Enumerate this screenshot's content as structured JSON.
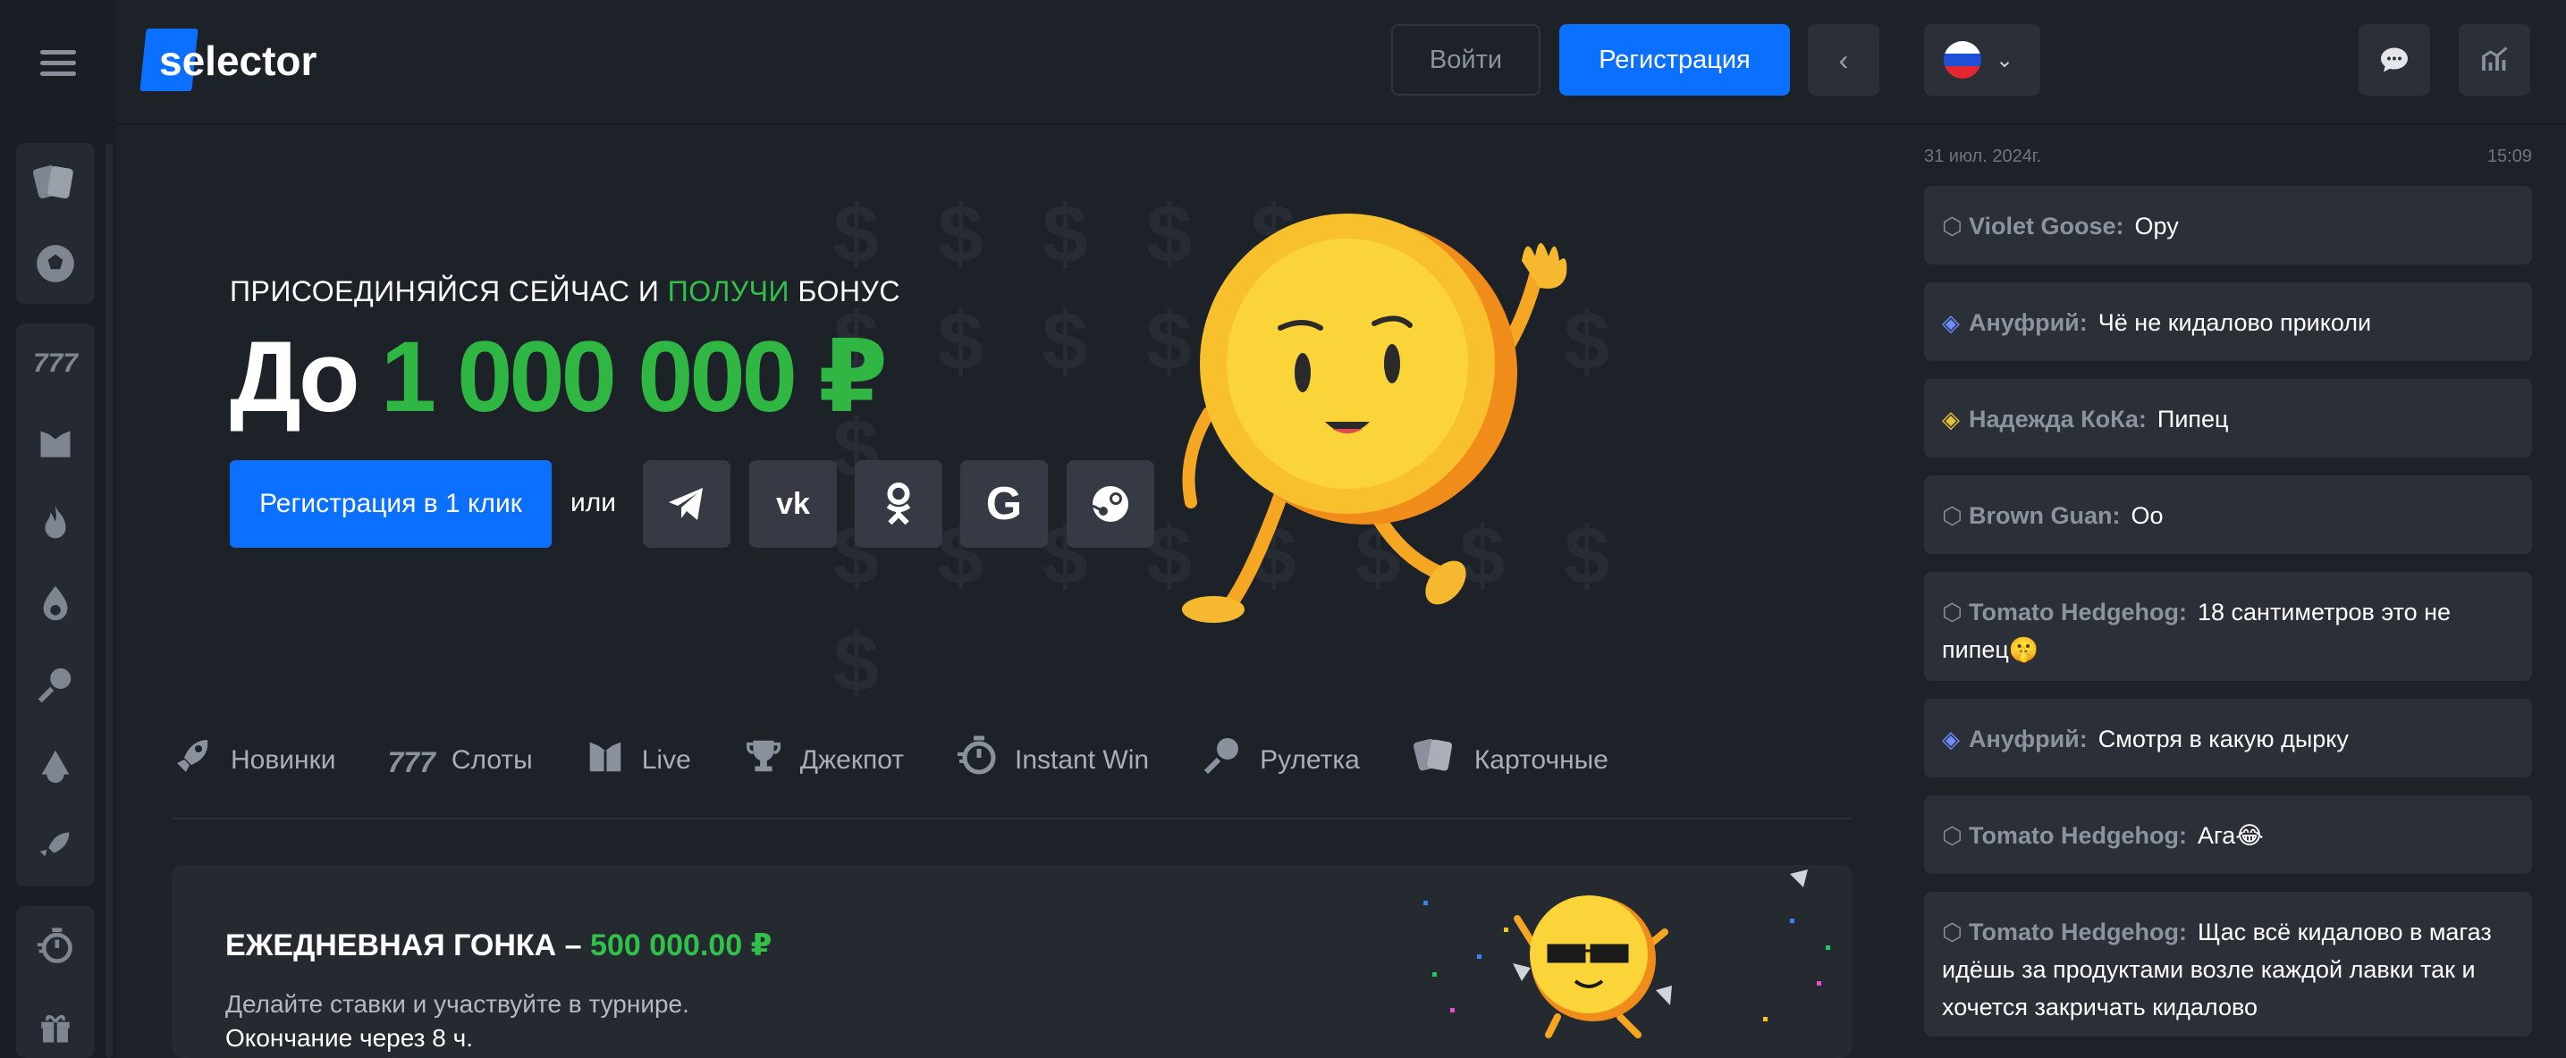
{
  "header": {
    "logo": "selector",
    "login_label": "Войти",
    "register_label": "Регистрация"
  },
  "colors": {
    "accent": "#0b6fff",
    "green": "#31c14a",
    "bg": "#1d2128"
  },
  "banner": {
    "sub_part1": "ПРИСОЕДИНЯЙСЯ СЕЙЧАС И ",
    "sub_green": "ПОЛУЧИ",
    "sub_part2": " БОНУС",
    "title_prefix": "До ",
    "title_amount": "1 000 000 ₽",
    "cta": "Регистрация в 1 клик",
    "or": "или",
    "socials": [
      "telegram-icon",
      "vk-icon",
      "odnoklassniki-icon",
      "google-icon",
      "steam-icon"
    ]
  },
  "tabs": [
    {
      "label": "Новинки",
      "icon": "rocket-icon"
    },
    {
      "label": "Слоты",
      "icon": "slots-777-icon"
    },
    {
      "label": "Live",
      "icon": "live-dealer-icon"
    },
    {
      "label": "Джекпот",
      "icon": "trophy-icon"
    },
    {
      "label": "Instant Win",
      "icon": "stopwatch-icon"
    },
    {
      "label": "Рулетка",
      "icon": "roulette-icon"
    },
    {
      "label": "Карточные",
      "icon": "cards-icon"
    }
  ],
  "tournament": {
    "title": "ЕЖЕДНЕВНАЯ ГОНКА – ",
    "amount": "500 000.00 ₽",
    "desc": "Делайте ставки и участвуйте в турнире.",
    "ends": "Окончание через 8 ч."
  },
  "chat": {
    "date": "31 июл. 2024г.",
    "time": "15:09",
    "messages": [
      {
        "user": "Violet Goose:",
        "text": "Ору",
        "badge": "hexagon-icon"
      },
      {
        "user": "Ануфрий:",
        "text": "Чё не кидалово приколи",
        "badge": "blue-stack-icon"
      },
      {
        "user": "Надежда КоКа:",
        "text": "Пипец",
        "badge": "gold-stack-icon"
      },
      {
        "user": "Brown Guan:",
        "text": "Оо",
        "badge": "hexagon-icon"
      },
      {
        "user": "Tomato Hedgehog:",
        "text": "18 сантиметров это не пипец🤫",
        "badge": "hexagon-icon"
      },
      {
        "user": "Ануфрий:",
        "text": "Смотря в какую дырку",
        "badge": "blue-stack-icon"
      },
      {
        "user": "Tomato Hedgehog:",
        "text": "Ага😂",
        "badge": "hexagon-icon"
      },
      {
        "user": "Tomato Hedgehog:",
        "text": "Щас всё кидалово в магаз идёшь за продуктами возле каждой лавки так и хочется закричать кидалово",
        "badge": "hexagon-icon"
      }
    ]
  }
}
